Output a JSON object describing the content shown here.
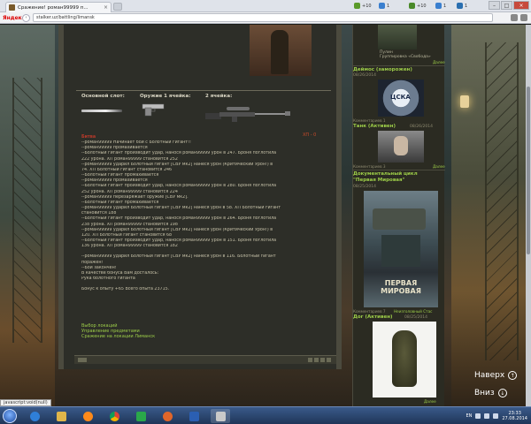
{
  "browser": {
    "tab_title": "Сражение! роман99999 п...",
    "tab_close": "×",
    "yandex": "Яндекс",
    "url": "stalker.uz/battling/limansk",
    "window_buttons": [
      "–",
      "□",
      "×"
    ],
    "extensions": [
      {
        "count": "+10",
        "color": "#5a9a2a"
      },
      {
        "count": "1",
        "color": "#3a7fcf"
      },
      {
        "count": "+10",
        "color": "#4a8a2a"
      },
      {
        "count": "1",
        "color": "#3a7fcf"
      },
      {
        "count": "1",
        "color": "#2a6fb0"
      }
    ]
  },
  "weapons": {
    "main_slot_label": "Основной слот:",
    "weapon1_label": "Оружие 1 ячейка:",
    "weapon2_label": "2 ячейка:"
  },
  "hp_text": "ХП - 0",
  "battle_log": {
    "header": "Битва",
    "lines": [
      "--роман99999 Начинает бой с Болотный гигант!!",
      "--роман99999 промахивается",
      "--Болотный гигант производит удар, нанося роман99999 урон в 247. Броня поглотила",
      "222 урона. ХП роман99999 становится 252",
      "--роман99999 ударил Болотный гигант [СВУ мк2] нанеся урон (Критический Урон!) в",
      "74. ХП Болотный гигант становится 246",
      "--Болотный гигант промахивается",
      "--роман99999 промахивается",
      "--Болотный гигант производит удар, нанося роман99999 урон в 280. Броня поглотила",
      "252 урона. ХП роман99999 становится 224",
      "--роман99999 перезаряжает оружие [СВУ мк2].",
      "--Болотный гигант промахивается",
      "--роман99999 ударил Болотный гигант [СВУ мк2] нанеся урон в 58. ХП Болотный гигант",
      "становится 188",
      "--Болотный гигант производит удар, нанося роман99999 урон в 264. Броня поглотила",
      "238 урона. ХП роман99999 становится 198",
      "--роман99999 ударил Болотный гигант [СВУ мк2] нанеся урон (Критический Урон!) в",
      "120. ХП Болотный гигант становится 68",
      "--Болотный гигант производит удар, нанося роман99999 урон в 151. Броня поглотила",
      "136 урона. ХП роман99999 становится 182",
      "",
      "--роман99999 ударил Болотный гигант [СВУ мк2] нанеся урон в 116. Болотный гигант",
      "поражён!",
      "--Бой закончен!",
      "В качестве бонуса Вам досталось:",
      "Рука болотного гиганта",
      "",
      "Бонус к опыту +65 Всего опыта 23715."
    ]
  },
  "links": [
    "Выбор локаций",
    "Управление предметами",
    "Сражение на локации Лиманск"
  ],
  "right_column": {
    "card1_caption1": "Пулин",
    "card1_caption2": "Группировка «Свобода»",
    "card1_link": "Далее",
    "post1_title": "Деймос (заморожен)",
    "post1_date": "08/26/2014",
    "post1_comments": "Комментариев 1",
    "post2_title": "Танк (Активен)",
    "post2_date": "08/26/2014",
    "post2_meta": "Комментариев 3",
    "post2_more": "Далее",
    "post3_title": "Документальный цикл",
    "post3_title2": "\"Первая Мировая\"",
    "post3_date": "08/25/2014",
    "poster_text": "ПЕРВАЯ МИРОВАЯ",
    "post3_meta": "Комментариев 7",
    "post3_meta2": "Неизголовный Стас",
    "post4_title": "Дог (Активен)",
    "post4_date": "08/25/2014",
    "post4_more": "Далее"
  },
  "scroll": {
    "up": "Наверх",
    "up_icon": "↑",
    "down": "Вниз",
    "down_icon": "↓"
  },
  "status_bar": "javascript:void(null)",
  "taskbar": {
    "lang": "EN",
    "time": "23:33",
    "date": "27.08.2014"
  }
}
